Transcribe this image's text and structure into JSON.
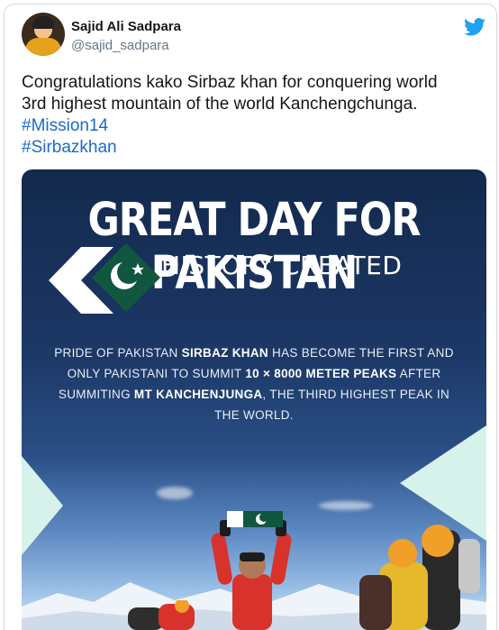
{
  "tweet": {
    "author": {
      "display_name": "Sajid Ali Sadpara",
      "handle": "@sajid_sadpara"
    },
    "text_lines": [
      "Congratulations kako Sirbaz khan for conquering world",
      "3rd highest mountain of the world Kanchengchunga."
    ],
    "hashtags": [
      "#Mission14",
      "#Sirbazkhan"
    ]
  },
  "poster": {
    "title": "GREAT DAY FOR PAKISTAN",
    "subtitle": "HISTORY CREATED",
    "body": {
      "part1": "PRIDE OF PAKISTAN ",
      "name": "SIRBAZ KHAN",
      "part2": " HAS BECOME THE FIRST AND ONLY PAKISTANI TO SUMMIT ",
      "peaks": "10 × 8000 METER PEAKS",
      "part3": " AFTER SUMMITING ",
      "mountain": "MT KANCHENJUNGA",
      "part4": ", THE THIRD HIGHEST PEAK IN THE WORLD."
    }
  },
  "icons": {
    "brand": "twitter-bird-icon",
    "flag": "pakistan-flag-icon"
  },
  "colors": {
    "hashtag": "#1b6ac9",
    "twitter_blue": "#1da1f2",
    "poster_navy": "#13294d",
    "flag_green": "#115740",
    "mint_accent": "#d6f2ea"
  }
}
